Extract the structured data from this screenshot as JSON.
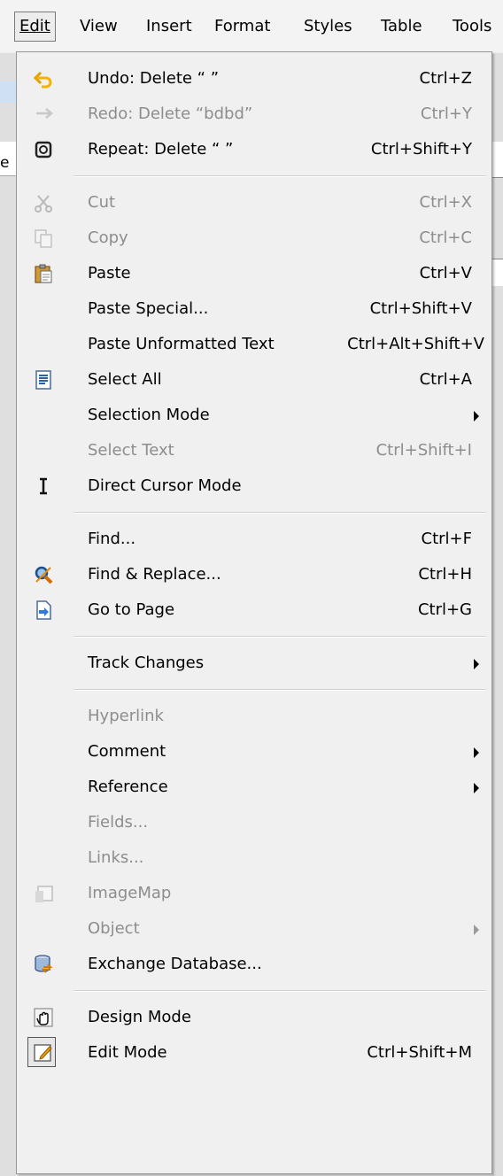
{
  "menubar": {
    "items": [
      "Edit",
      "View",
      "Insert",
      "Format",
      "Styles",
      "Table",
      "Tools"
    ]
  },
  "background": {
    "fragment": "e"
  },
  "menu": {
    "items": [
      {
        "label": "Undo: Delete “ ”",
        "shortcut": "Ctrl+Z",
        "icon": "undo-icon",
        "enabled": true
      },
      {
        "label": "Redo: Delete “bdbd”",
        "shortcut": "Ctrl+Y",
        "icon": "redo-icon",
        "enabled": false
      },
      {
        "label": "Repeat: Delete “ ”",
        "shortcut": "Ctrl+Shift+Y",
        "icon": "repeat-icon",
        "enabled": true
      },
      {
        "label": "Cut",
        "shortcut": "Ctrl+X",
        "icon": "cut-icon",
        "enabled": false
      },
      {
        "label": "Copy",
        "shortcut": "Ctrl+C",
        "icon": "copy-icon",
        "enabled": false
      },
      {
        "label": "Paste",
        "shortcut": "Ctrl+V",
        "icon": "paste-icon",
        "enabled": true
      },
      {
        "label": "Paste Special...",
        "shortcut": "Ctrl+Shift+V",
        "enabled": true
      },
      {
        "label": "Paste Unformatted Text",
        "shortcut": "Ctrl+Alt+Shift+V",
        "enabled": true
      },
      {
        "label": "Select All",
        "shortcut": "Ctrl+A",
        "icon": "select-all-icon",
        "enabled": true
      },
      {
        "label": "Selection Mode",
        "submenu": true,
        "enabled": true
      },
      {
        "label": "Select Text",
        "shortcut": "Ctrl+Shift+I",
        "enabled": false
      },
      {
        "label": "Direct Cursor Mode",
        "icon": "text-cursor-icon",
        "enabled": true
      },
      {
        "label": "Find...",
        "shortcut": "Ctrl+F",
        "enabled": true
      },
      {
        "label": "Find & Replace...",
        "shortcut": "Ctrl+H",
        "icon": "find-replace-icon",
        "enabled": true
      },
      {
        "label": "Go to Page",
        "shortcut": "Ctrl+G",
        "icon": "go-to-page-icon",
        "enabled": true
      },
      {
        "label": "Track Changes",
        "submenu": true,
        "enabled": true
      },
      {
        "label": "Hyperlink",
        "enabled": false
      },
      {
        "label": "Comment",
        "submenu": true,
        "enabled": true
      },
      {
        "label": "Reference",
        "submenu": true,
        "enabled": true
      },
      {
        "label": "Fields...",
        "enabled": false
      },
      {
        "label": "Links...",
        "enabled": false
      },
      {
        "label": "ImageMap",
        "icon": "imagemap-icon",
        "enabled": false
      },
      {
        "label": "Object",
        "submenu": true,
        "enabled": false
      },
      {
        "label": "Exchange Database...",
        "icon": "database-icon",
        "enabled": true
      },
      {
        "label": "Design Mode",
        "icon": "design-mode-icon",
        "enabled": true
      },
      {
        "label": "Edit Mode",
        "shortcut": "Ctrl+Shift+M",
        "icon": "edit-mode-icon",
        "enabled": true,
        "checked": true
      }
    ]
  }
}
